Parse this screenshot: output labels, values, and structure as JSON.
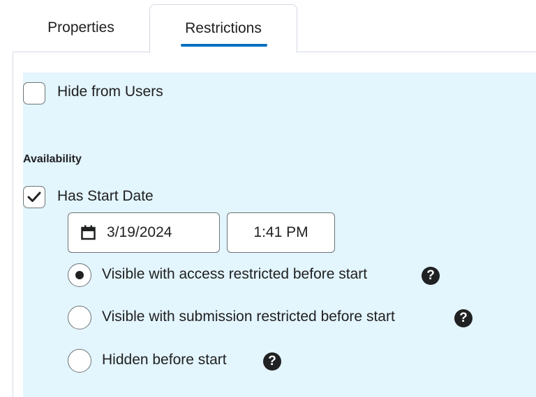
{
  "tabs": [
    {
      "label": "Properties",
      "active": false
    },
    {
      "label": "Restrictions",
      "active": true
    }
  ],
  "accent_color": "#006fbf",
  "panel_color": "#e3f5fd",
  "hide_from_users": {
    "label": "Hide from Users",
    "checked": false
  },
  "availability": {
    "heading": "Availability",
    "has_start_date": {
      "label": "Has Start Date",
      "checked": true
    },
    "start_date": "3/19/2024",
    "start_time": "1:41 PM",
    "options": [
      {
        "label": "Visible with access restricted before start",
        "selected": true,
        "help_icon": "question-circle-icon"
      },
      {
        "label": "Visible with submission restricted before start",
        "selected": false,
        "help_icon": "question-circle-icon"
      },
      {
        "label": "Hidden before start",
        "selected": false,
        "help_icon": "question-circle-icon"
      }
    ]
  },
  "icons": {
    "calendar": "calendar-icon",
    "check": "checkmark-icon",
    "help_glyph": "?"
  }
}
